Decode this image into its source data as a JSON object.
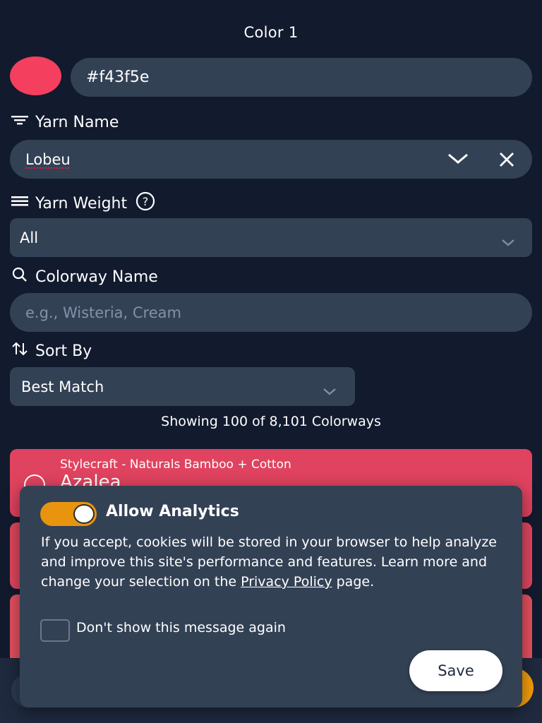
{
  "header": {
    "title": "Color 1"
  },
  "color": {
    "hex_value": "#f43f5e",
    "swatch_color": "#f43f5e"
  },
  "yarn_name": {
    "label": "Yarn Name",
    "value": "Lobeu"
  },
  "yarn_weight": {
    "label": "Yarn Weight",
    "selected": "All"
  },
  "colorway_name": {
    "label": "Colorway Name",
    "placeholder": "e.g., Wisteria, Cream"
  },
  "sort_by": {
    "label": "Sort By",
    "selected": "Best Match"
  },
  "results": {
    "summary": "Showing 100 of 8,101 Colorways",
    "items": [
      {
        "brand": "Stylecraft - Naturals Bamboo + Cotton",
        "name": "Azalea"
      }
    ]
  },
  "analytics_dialog": {
    "title": "Allow Analytics",
    "toggle_on": true,
    "body_text": "If you accept, cookies will be stored in your browser to help analyze and improve this site's performance and features. Learn more and change your selection on the ",
    "link_text": "Privacy Policy",
    "body_suffix": " page.",
    "checkbox_label": "Don't show this message again",
    "save_label": "Save"
  },
  "colors": {
    "background": "#121a2e",
    "field": "#334155",
    "accent": "#f59e0b",
    "card": "#e0435f"
  }
}
